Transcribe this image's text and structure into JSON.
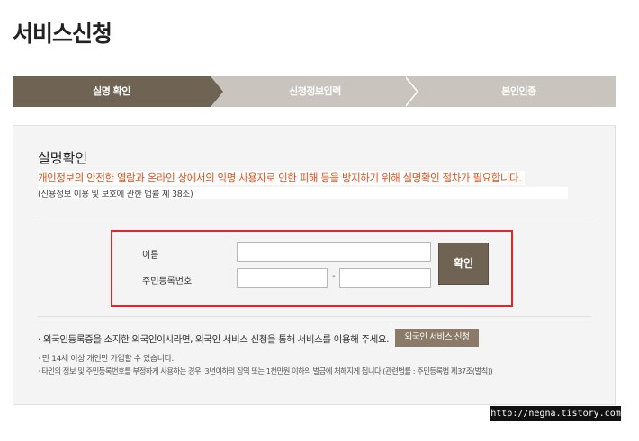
{
  "page": {
    "title": "서비스신청"
  },
  "steps": [
    {
      "label": "실명 확인",
      "active": true
    },
    {
      "label": "신청정보입력",
      "active": false
    },
    {
      "label": "본인인증",
      "active": false
    }
  ],
  "colors": {
    "active_step": "#6f6353",
    "inactive_step": "#c9c4bd",
    "highlight_border": "#e3262a",
    "warning_text": "#e0531d"
  },
  "section": {
    "title": "실명확인",
    "description": "개인정보의 안전한 열람과 온라인 상에서의 익명 사용자로 인한 피해 등을 방지하기 위해 실명확인 절차가 필요합니다.",
    "law": "(신용정보 이용 및 보호에 관한 법률 제 38조)"
  },
  "form": {
    "name_label": "이름",
    "name_value": "",
    "rrn_label": "주민등록번호",
    "rrn_front_value": "",
    "rrn_back_value": "",
    "dash": "-",
    "confirm_label": "확인"
  },
  "notices": {
    "foreign": "· 외국인등록증을 소지한 외국인이시라면, 외국인 서비스 신청을 통해 서비스를 이용해 주세요.",
    "foreign_button": "외국인 서비스 신청",
    "age": "· 만 14세 이상 개인만 가입할 수 있습니다.",
    "penalty": "· 타인의 정보 및 주민등록번호를 부정하게 사용하는 경우, 3년이하의 징역 또는 1천만원 이하의 벌금에 처해지게 됩니다.(관련법률 : 주민등록법 제37조(벌칙))"
  },
  "watermark": "http://negna.tistory.com"
}
